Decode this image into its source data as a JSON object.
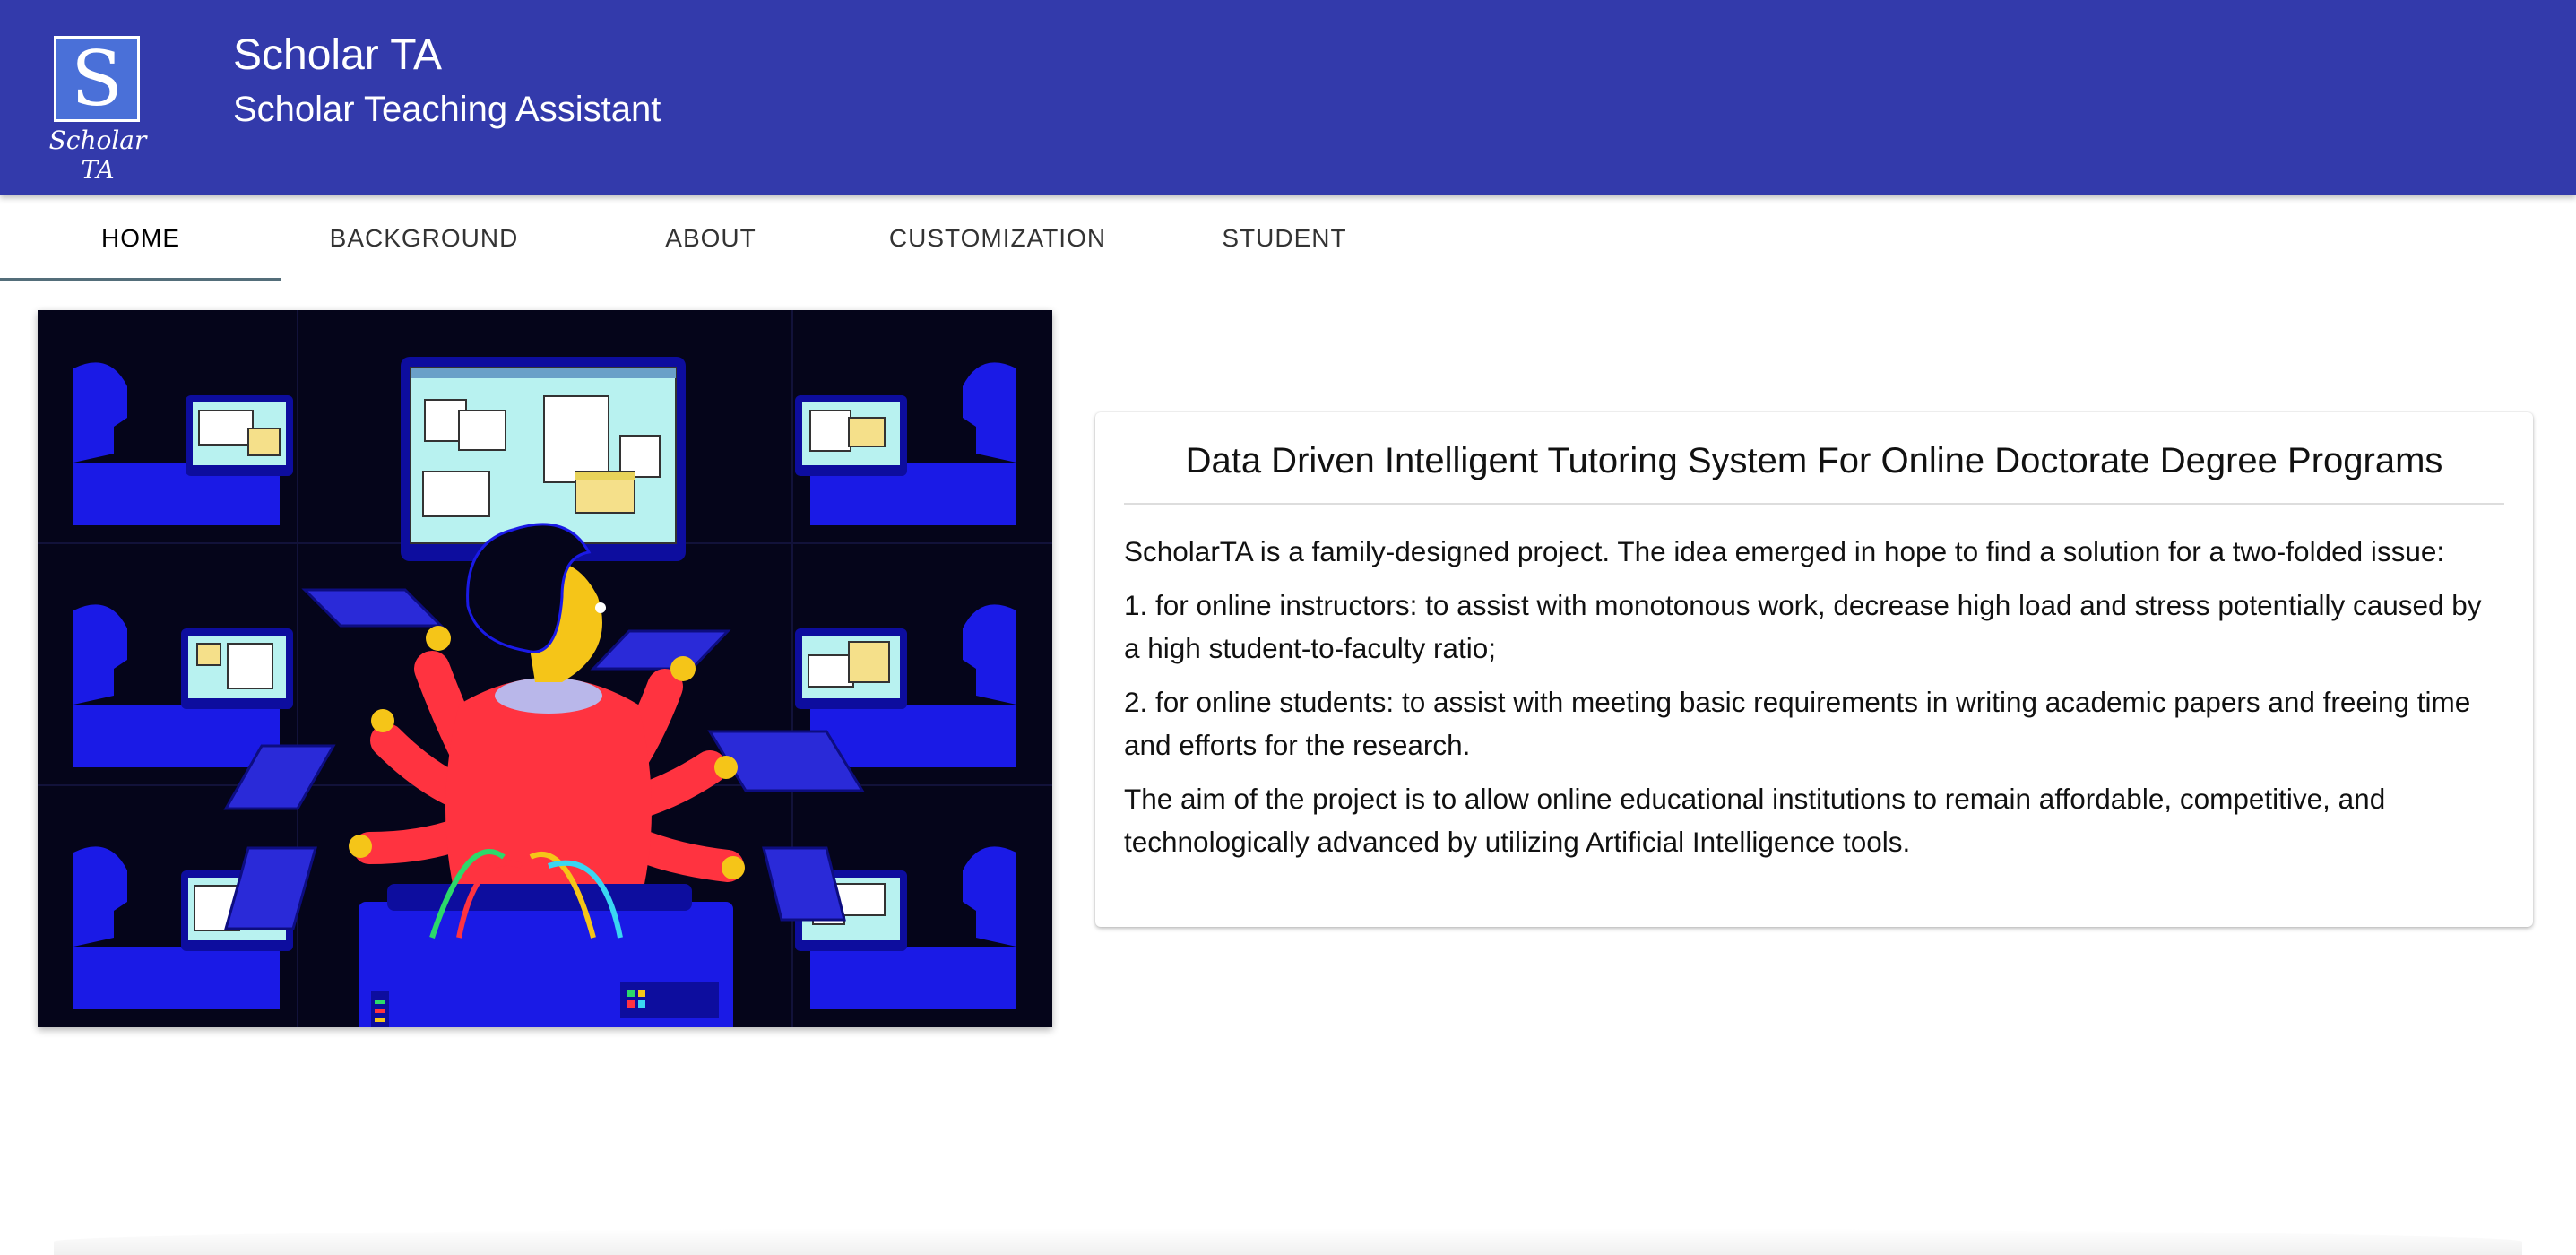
{
  "header": {
    "logo_letter": "S",
    "logo_caption": "Scholar TA",
    "title": "Scholar TA",
    "subtitle": "Scholar Teaching Assistant"
  },
  "tabs": [
    {
      "label": "HOME",
      "active": true
    },
    {
      "label": "BACKGROUND",
      "active": false
    },
    {
      "label": "ABOUT",
      "active": false
    },
    {
      "label": "CUSTOMIZATION",
      "active": false
    },
    {
      "label": "STUDENT",
      "active": false
    }
  ],
  "card": {
    "title": "Data Driven Intelligent Tutoring System For Online Doctorate Degree Programs",
    "paragraphs": [
      "ScholarTA is a family-designed project. The idea emerged in hope to find a solution for a two-folded issue:",
      "1. for online instructors: to assist with monotonous work, decrease high load and stress potentially caused by a high student-to-faculty ratio;",
      "2. for online students: to assist with meeting basic requirements in writing academic papers and freeing time and efforts for the research.",
      "The aim of the project is to allow online educational institutions to remain affordable, competitive, and technologically advanced by utilizing Artificial Intelligence tools."
    ]
  },
  "colors": {
    "header_bg": "#333aab",
    "tab_indicator": "#546e7a",
    "hero_bg": "#05051a",
    "hero_blue": "#1a1ae6",
    "hero_red": "#ff3340",
    "hero_yellow": "#f5c518",
    "screen_cyan": "#b8f2f0"
  }
}
